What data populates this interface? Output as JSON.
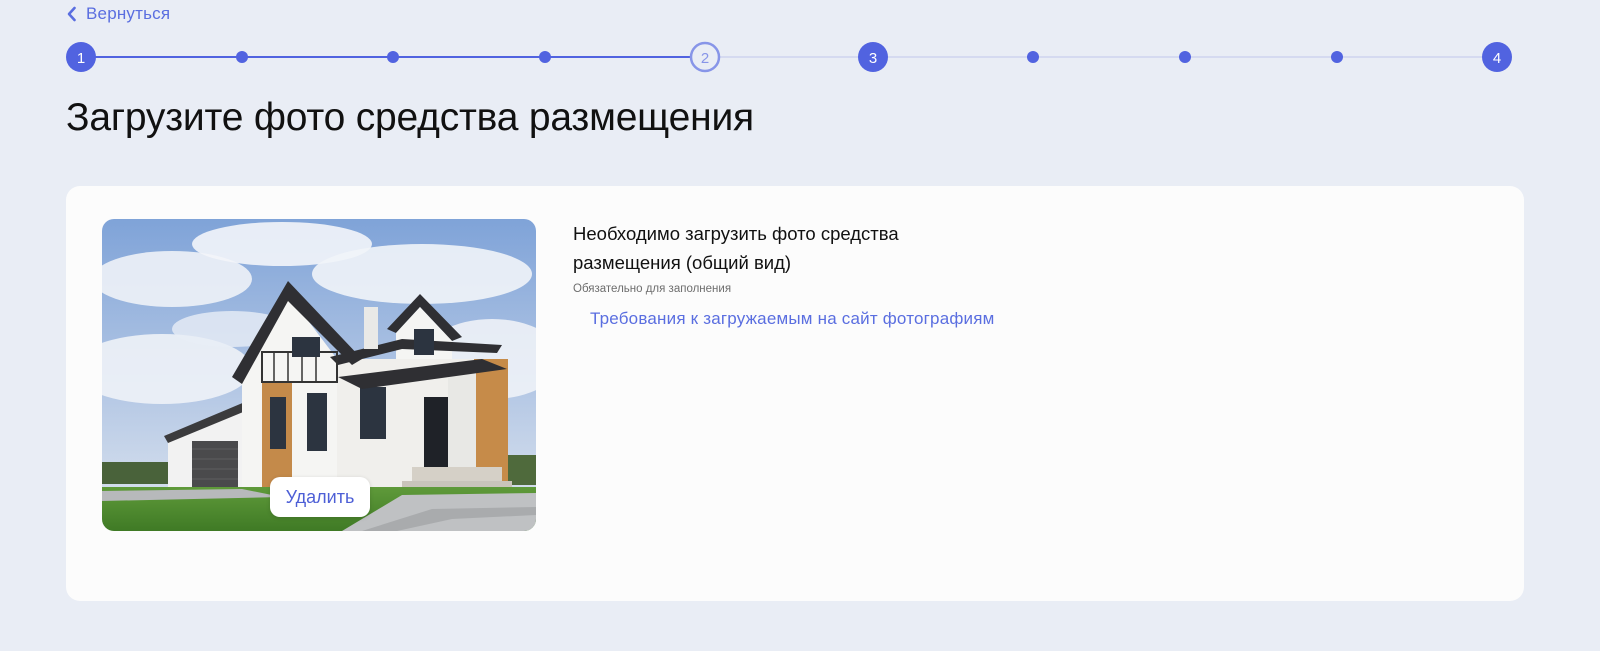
{
  "nav": {
    "back_label": "Вернуться"
  },
  "stepper": {
    "steps": [
      "1",
      "2",
      "3",
      "4"
    ],
    "current_step": 2,
    "colors": {
      "active": "#5163e0",
      "inactive_line": "#d5daf0",
      "current_ring": "#8795e8"
    }
  },
  "page": {
    "title": "Загрузите фото средства размещения"
  },
  "upload": {
    "description": "Необходимо загрузить фото средства размещения (общий вид)",
    "required_hint": "Обязательно для заполнения",
    "requirements_link": "Требования к загружаемым на сайт фотографиям",
    "delete_label": "Удалить"
  }
}
